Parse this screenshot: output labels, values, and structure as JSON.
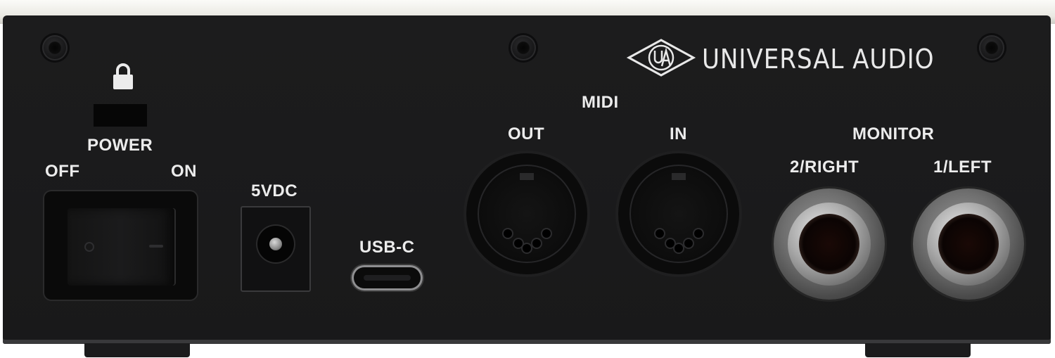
{
  "brand": {
    "name": "UNIVERSAL AUDIO"
  },
  "labels": {
    "power": "POWER",
    "off": "OFF",
    "on": "ON",
    "dc": "5VDC",
    "usb": "USB-C",
    "midi": "MIDI",
    "midi_out": "OUT",
    "midi_in": "IN",
    "monitor": "MONITOR",
    "monitor_right": "2/RIGHT",
    "monitor_left": "1/LEFT"
  },
  "icons": [
    "lock-icon",
    "ua-logo-icon",
    "power-rocker-switch",
    "dc-power-jack",
    "usb-c-port",
    "midi-out-port",
    "midi-in-port",
    "monitor-right-jack",
    "monitor-left-jack"
  ],
  "colors": {
    "panel": "#1b1b1c",
    "text": "#ececec",
    "trim": "#ecebe6"
  }
}
